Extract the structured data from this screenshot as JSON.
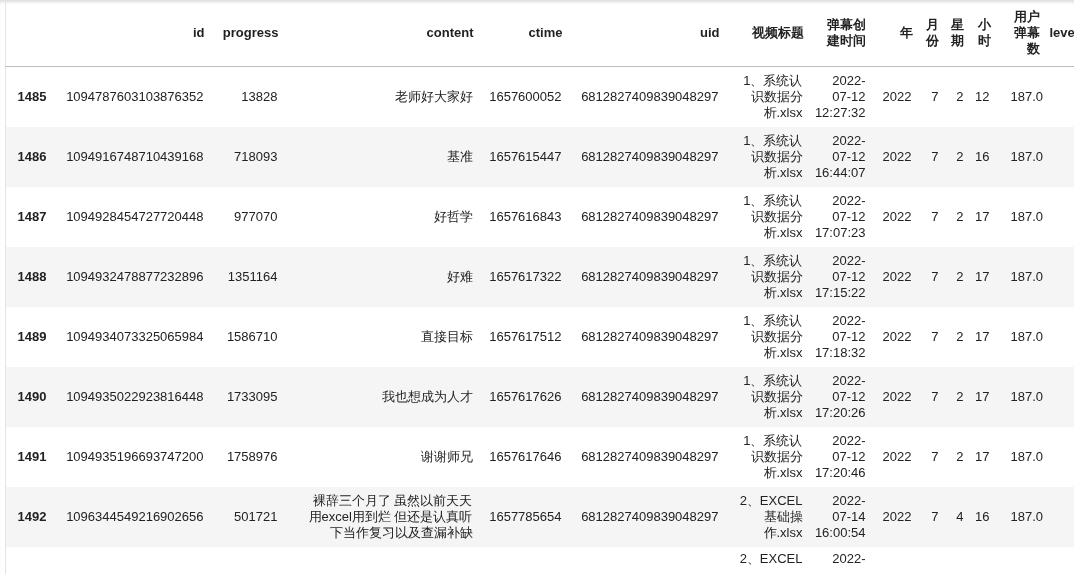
{
  "table": {
    "columns": [
      "id",
      "progress",
      "content",
      "ctime",
      "uid",
      "视频标题",
      "弹幕创建时间",
      "年",
      "月份",
      "星期",
      "小时",
      "用户弹幕数",
      "leve"
    ],
    "rows": [
      {
        "index": "1485",
        "cells": [
          "1094787603103876352",
          "13828",
          "老师好大家好",
          "1657600052",
          "6812827409839048297",
          "1、系统认识数据分析.xlsx",
          "2022-07-12 12:27:32",
          "2022",
          "7",
          "2",
          "12",
          "187.0"
        ]
      },
      {
        "index": "1486",
        "cells": [
          "1094916748710439168",
          "718093",
          "基准",
          "1657615447",
          "6812827409839048297",
          "1、系统认识数据分析.xlsx",
          "2022-07-12 16:44:07",
          "2022",
          "7",
          "2",
          "16",
          "187.0"
        ]
      },
      {
        "index": "1487",
        "cells": [
          "1094928454727720448",
          "977070",
          "好哲学",
          "1657616843",
          "6812827409839048297",
          "1、系统认识数据分析.xlsx",
          "2022-07-12 17:07:23",
          "2022",
          "7",
          "2",
          "17",
          "187.0"
        ]
      },
      {
        "index": "1488",
        "cells": [
          "1094932478877232896",
          "1351164",
          "好难",
          "1657617322",
          "6812827409839048297",
          "1、系统认识数据分析.xlsx",
          "2022-07-12 17:15:22",
          "2022",
          "7",
          "2",
          "17",
          "187.0"
        ]
      },
      {
        "index": "1489",
        "cells": [
          "1094934073325065984",
          "1586710",
          "直接目标",
          "1657617512",
          "6812827409839048297",
          "1、系统认识数据分析.xlsx",
          "2022-07-12 17:18:32",
          "2022",
          "7",
          "2",
          "17",
          "187.0"
        ]
      },
      {
        "index": "1490",
        "cells": [
          "1094935022923816448",
          "1733095",
          "我也想成为人才",
          "1657617626",
          "6812827409839048297",
          "1、系统认识数据分析.xlsx",
          "2022-07-12 17:20:26",
          "2022",
          "7",
          "2",
          "17",
          "187.0"
        ]
      },
      {
        "index": "1491",
        "cells": [
          "1094935196693747200",
          "1758976",
          "谢谢师兄",
          "1657617646",
          "6812827409839048297",
          "1、系统认识数据分析.xlsx",
          "2022-07-12 17:20:46",
          "2022",
          "7",
          "2",
          "17",
          "187.0"
        ]
      },
      {
        "index": "1492",
        "cells": [
          "1096344549216902656",
          "501721",
          "裸辞三个月了 虽然以前天天用excel用到烂 但还是认真听下当作复习以及查漏补缺",
          "1657785654",
          "6812827409839048297",
          "2、EXCEL基础操作.xlsx",
          "2022-07-14 16:00:54",
          "2022",
          "7",
          "4",
          "16",
          "187.0"
        ]
      }
    ],
    "partial_row": {
      "video_title": "2、EXCEL",
      "created_time": "2022-"
    }
  }
}
